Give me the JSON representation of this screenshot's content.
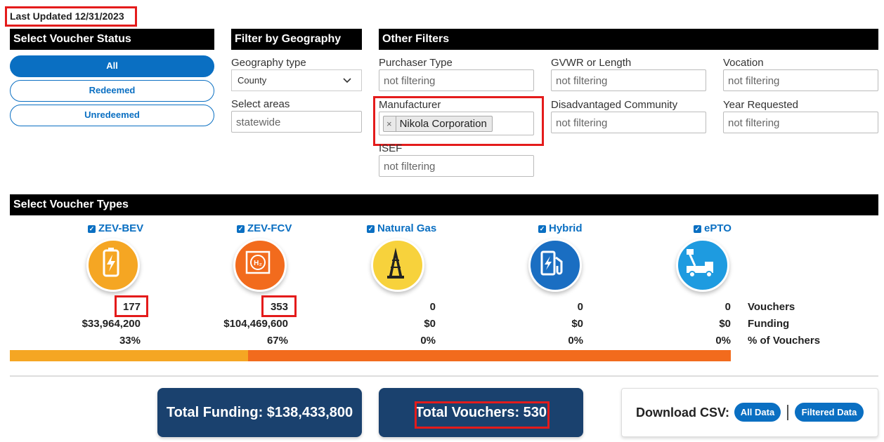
{
  "last_updated": "Last Updated 12/31/2023",
  "voucher_status": {
    "header": "Select Voucher Status",
    "buttons": [
      "All",
      "Redeemed",
      "Unredeemed"
    ]
  },
  "geography": {
    "header": "Filter by Geography",
    "type_label": "Geography type",
    "type_value": "County",
    "areas_label": "Select areas",
    "areas_value": "statewide"
  },
  "other_filters": {
    "header": "Other Filters",
    "purchaser_type": {
      "label": "Purchaser Type",
      "value": "not filtering"
    },
    "gvwr": {
      "label": "GVWR or Length",
      "value": "not filtering"
    },
    "vocation": {
      "label": "Vocation",
      "value": "not filtering"
    },
    "manufacturer": {
      "label": "Manufacturer",
      "chip_remove": "×",
      "chip": "Nikola Corporation"
    },
    "disadvantaged": {
      "label": "Disadvantaged Community",
      "value": "not filtering"
    },
    "year_requested": {
      "label": "Year Requested",
      "value": "not filtering"
    },
    "isef": {
      "label": "ISEF",
      "value": "not filtering"
    }
  },
  "voucher_types": {
    "header": "Select Voucher Types",
    "types": [
      {
        "label": "ZEV-BEV",
        "icon": "battery-icon",
        "color": "#f5a623",
        "vouchers": "177",
        "funding": "$33,964,200",
        "percent": "33%"
      },
      {
        "label": "ZEV-FCV",
        "icon": "hydrogen-icon",
        "color": "#f26b1d",
        "vouchers": "353",
        "funding": "$104,469,600",
        "percent": "67%"
      },
      {
        "label": "Natural Gas",
        "icon": "derrick-icon",
        "color": "#f7d23c",
        "vouchers": "0",
        "funding": "$0",
        "percent": "0%"
      },
      {
        "label": "Hybrid",
        "icon": "hybrid-fuel-icon",
        "color": "#1a6ec2",
        "vouchers": "0",
        "funding": "$0",
        "percent": "0%"
      },
      {
        "label": "ePTO",
        "icon": "bucket-truck-icon",
        "color": "#1e9be0",
        "vouchers": "0",
        "funding": "$0",
        "percent": "0%"
      }
    ],
    "row_labels": [
      "Vouchers",
      "Funding",
      "% of Vouchers"
    ],
    "bar": [
      {
        "fraction": 0.33,
        "color": "#f5a623"
      },
      {
        "fraction": 0.67,
        "color": "#f26b1d"
      }
    ]
  },
  "totals": {
    "funding": "Total Funding: $138,433,800",
    "vouchers": "Total Vouchers: 530"
  },
  "download": {
    "label": "Download CSV:",
    "all": "All Data",
    "filtered": "Filtered Data"
  }
}
